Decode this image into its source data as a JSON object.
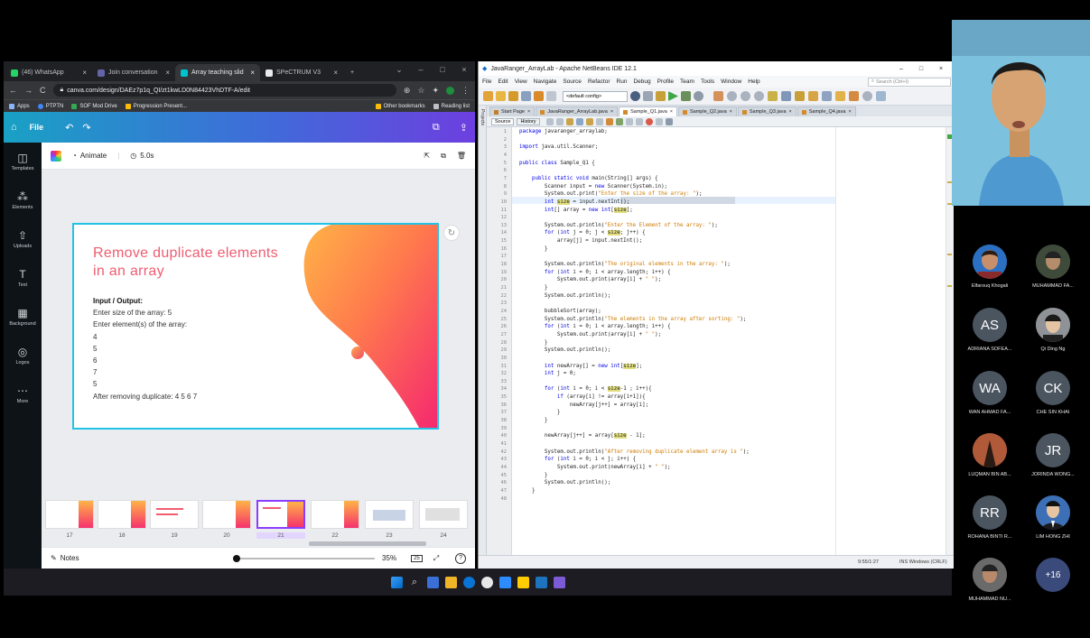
{
  "chrome": {
    "tabs": [
      {
        "label": "(46) WhatsApp",
        "color": "#25d366"
      },
      {
        "label": "Join conversation",
        "color": "#6264a7"
      },
      {
        "label": "Array teaching slid",
        "color": "#00c4cc"
      },
      {
        "label": "SPeCTRUM V3",
        "color": "#e8eaed"
      }
    ],
    "url": "canva.com/design/DAEz7p1q_QI/zt1kwLD0N84423VhDTF-A/edit",
    "bookmarks": [
      "Apps",
      "PTPTN",
      "SOF Mod Drive",
      "Progression Present...",
      "Other bookmarks",
      "Reading list"
    ]
  },
  "canva": {
    "file_label": "File",
    "animate_label": "Animate",
    "duration": "5.0s",
    "sidebar": [
      "Templates",
      "Elements",
      "Uploads",
      "Text",
      "Background",
      "Logos",
      "More"
    ],
    "slide": {
      "title": "Remove duplicate elements in an array",
      "io_heading": "Input / Output:",
      "lines": [
        "Enter size of the array: 5",
        "Enter element(s) of the array:",
        "4",
        "5",
        "6",
        "7",
        "5",
        "After removing duplicate: 4 5 6 7"
      ]
    },
    "thumb_numbers": [
      "17",
      "18",
      "19",
      "20",
      "21",
      "22",
      "23",
      "24"
    ],
    "notes_label": "Notes",
    "zoom": "35%",
    "page_count": "25"
  },
  "netbeans": {
    "title": "JavaRanger_ArrayLab - Apache NetBeans IDE 12.1",
    "menu": [
      "File",
      "Edit",
      "View",
      "Navigate",
      "Source",
      "Refactor",
      "Run",
      "Debug",
      "Profile",
      "Team",
      "Tools",
      "Window",
      "Help"
    ],
    "search_placeholder": "Search (Ctrl+I)",
    "config": "<default config>",
    "tabs": [
      "Start Page",
      "JavaRanger_ArrayLab.java",
      "Sample_Q1.java",
      "Sample_Q2.java",
      "Sample_Q3.java",
      "Sample_Q4.java"
    ],
    "source_tab": "Source",
    "history_tab": "History",
    "projects_label": "Projects",
    "code": [
      "package javaranger_arraylab;",
      "",
      "import java.util.Scanner;",
      "",
      "public class Sample_Q1 {",
      "",
      "    public static void main(String[] args) {",
      "        Scanner input = new Scanner(System.in);",
      "        System.out.print(\"Enter the size of the array: \");",
      "        int size = input.nextInt();",
      "        int[] array = new int[size];",
      "",
      "        System.out.println(\"Enter the Element of the array: \");",
      "        for (int j = 0; j < size; j++) {",
      "            array[j] = input.nextInt();",
      "        }",
      "",
      "        System.out.println(\"The original elements in the array: \");",
      "        for (int i = 0; i < array.length; i++) {",
      "            System.out.print(array[i] + \" \");",
      "        }",
      "        System.out.println();",
      "",
      "        bubbleSort(array);",
      "        System.out.println(\"The elements in the array after sorting: \");",
      "        for (int i = 0; i < array.length; i++) {",
      "            System.out.print(array[i] + \" \");",
      "        }",
      "        System.out.println();",
      "",
      "        int newArray[] = new int[size];",
      "        int j = 0;",
      "",
      "        for (int i = 0; i < size-1 ; i++){",
      "            if (array[i] != array[i+1]){",
      "                newArray[j++] = array[i];",
      "            }",
      "        }",
      "",
      "        newArray[j++] = array[size - 1];",
      "",
      "        System.out.println(\"After removing duplicate element array is \");",
      "        for (int i = 0; i < j; i++) {",
      "            System.out.print(newArray[i] + \" \");",
      "        }",
      "        System.out.println();",
      "    }",
      ""
    ],
    "status_pos": "9:55/1:27",
    "status_mode": "INS Windows (CRLF)"
  },
  "zoom": {
    "participants": [
      {
        "name": "Elfarouq Khogali",
        "initials": "",
        "color": "#3a4d6b"
      },
      {
        "name": "MUHAMMAD FA...",
        "initials": "",
        "color": "#4a4a40"
      },
      {
        "name": "ADRIANA SOFEA...",
        "initials": "AS",
        "color": "#4b5560"
      },
      {
        "name": "Qi Ding Ng",
        "initials": "",
        "color": "#6b6e72"
      },
      {
        "name": "WAN AHMAD FA...",
        "initials": "WA",
        "color": "#4b5560"
      },
      {
        "name": "CHE SIN KHAI",
        "initials": "CK",
        "color": "#4b5560"
      },
      {
        "name": "LUQMAN BIN AB...",
        "initials": "",
        "color": "#8a4a3a"
      },
      {
        "name": "JORINDA WONG...",
        "initials": "JR",
        "color": "#4b5560"
      },
      {
        "name": "ROHANA BINTI R...",
        "initials": "RR",
        "color": "#4b5560"
      },
      {
        "name": "LIM HONG ZHI",
        "initials": "",
        "color": "#2d4a78"
      },
      {
        "name": "MUHAMMAD NU...",
        "initials": "",
        "color": "#5a5a5a"
      },
      {
        "name": "",
        "initials": "+16",
        "color": "#3a4a7a"
      }
    ]
  }
}
